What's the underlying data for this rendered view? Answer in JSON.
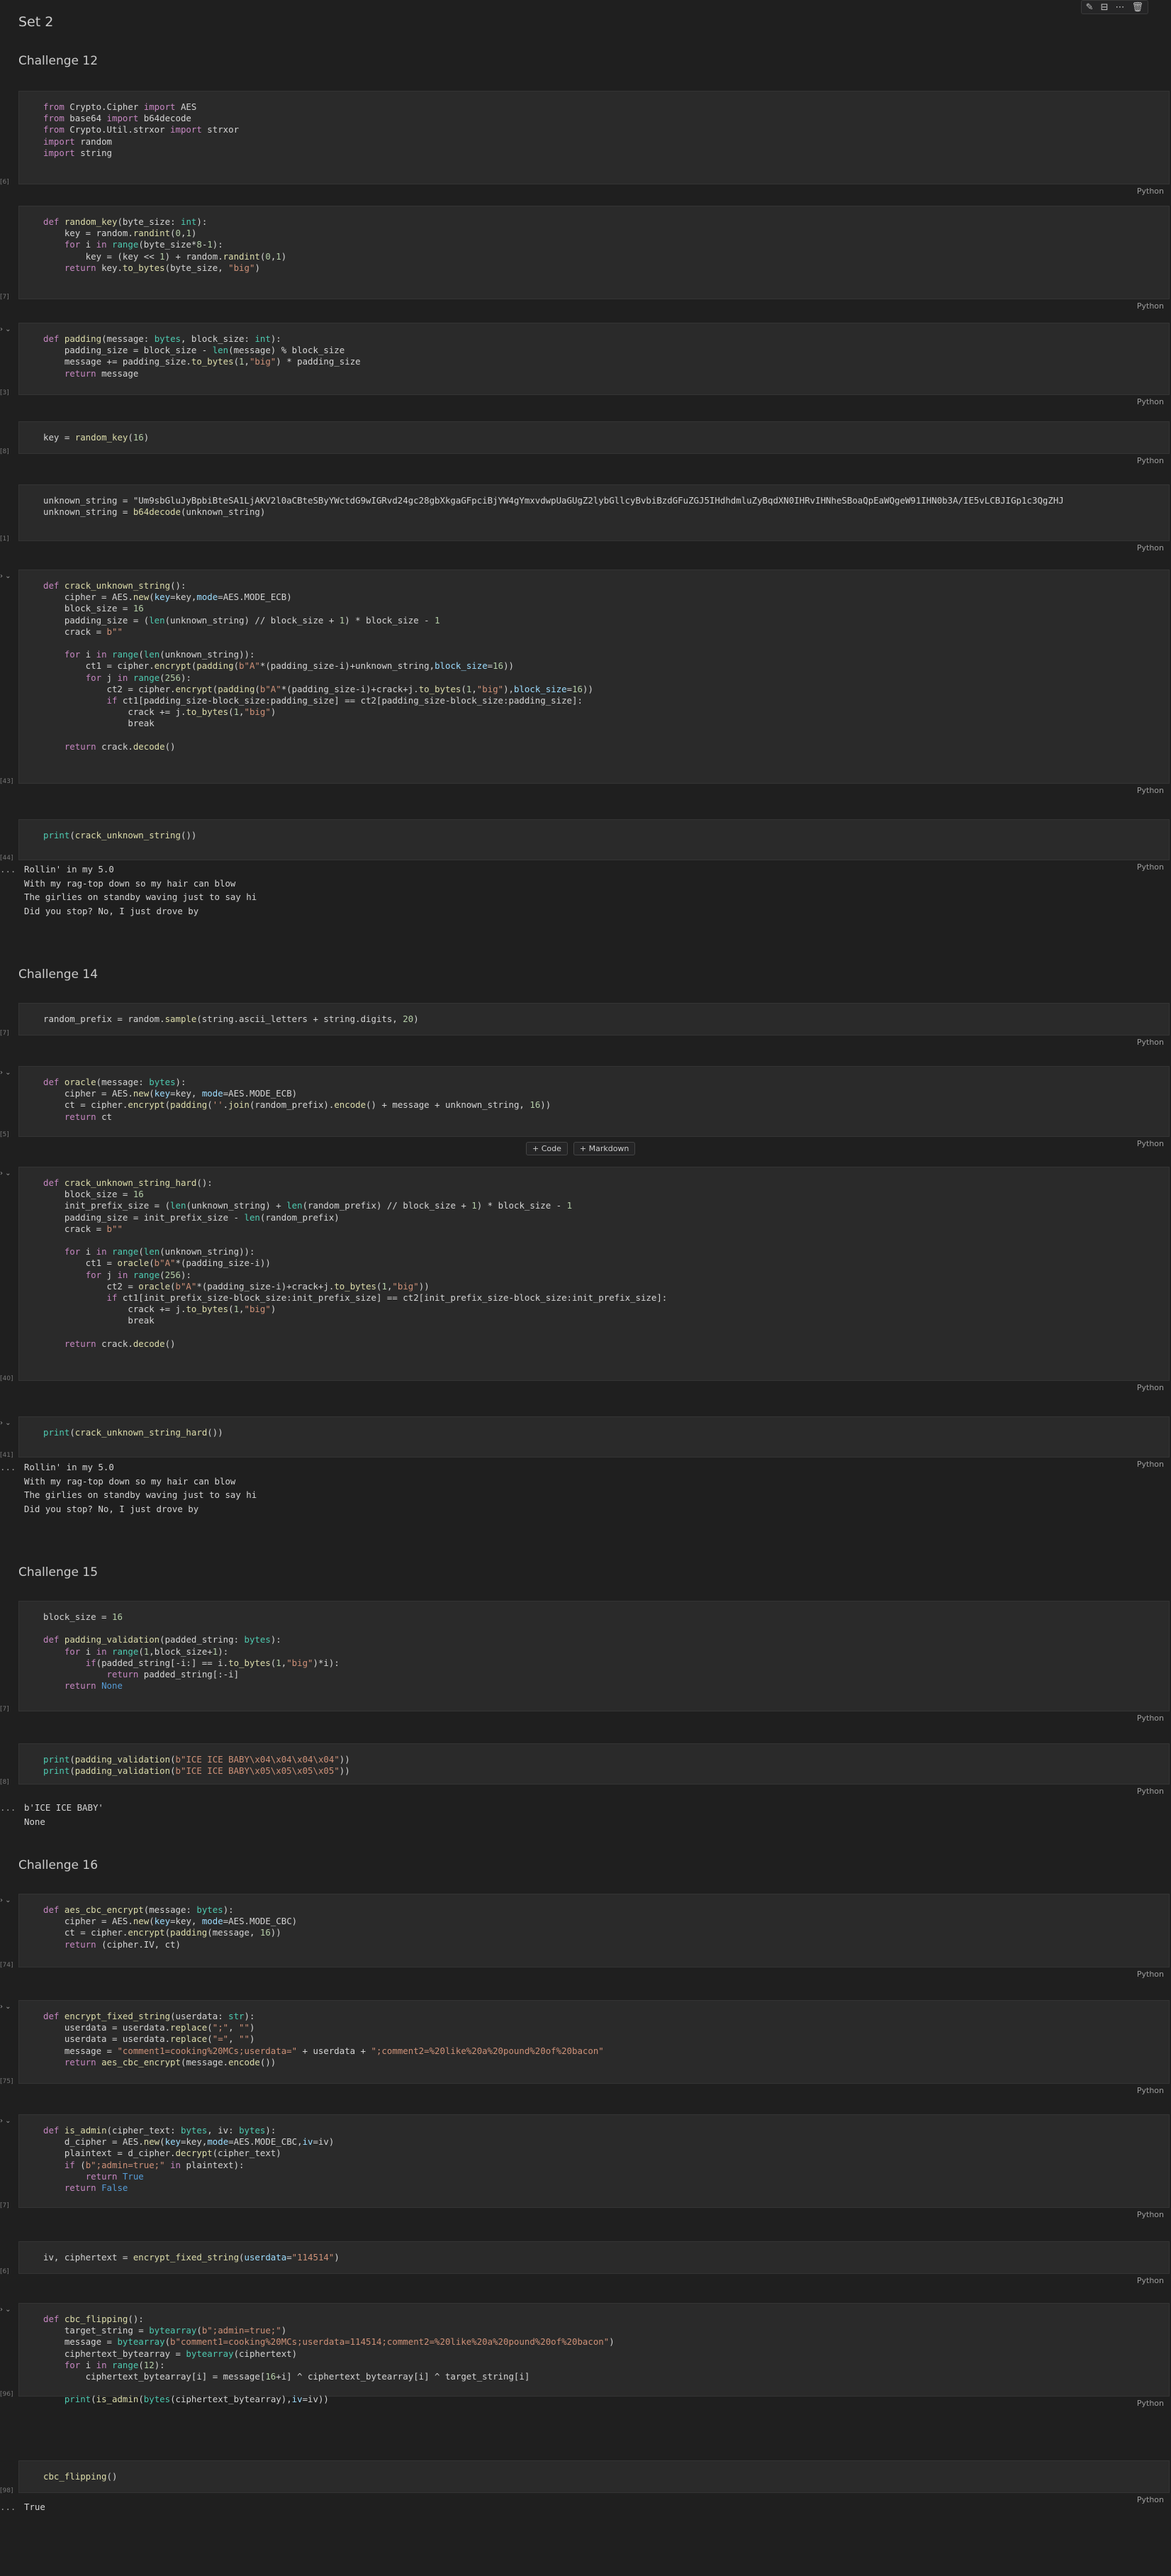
{
  "toolbar": {
    "items": [
      "✎",
      "⊟",
      "⋯",
      "🗑"
    ]
  },
  "insert": {
    "code": "+ Code",
    "markdown": "+ Markdown"
  },
  "headings": {
    "set": "Set 2",
    "c12": "Challenge 12",
    "c14": "Challenge 14",
    "c15": "Challenge 15",
    "c16": "Challenge 16"
  },
  "lang": "Python",
  "outputs": {
    "o1": "Rollin' in my 5.0\nWith my rag-top down so my hair can blow\nThe girlies on standby waving just to say hi\nDid you stop? No, I just drove by",
    "o2": "Rollin' in my 5.0\nWith my rag-top down so my hair can blow\nThe girlies on standby waving just to say hi\nDid you stop? No, I just drove by",
    "o3": "b'ICE ICE BABY'\nNone",
    "o4": "True"
  },
  "cells": [
    "from Crypto.Cipher import AES\nfrom base64 import b64decode\nfrom Crypto.Util.strxor import strxor\nimport random\nimport string",
    "def random_key(byte_size: int):\n    key = random.randint(0,1)\n    for i in range(byte_size*8-1):\n        key = (key << 1) + random.randint(0,1)\n    return key.to_bytes(byte_size, \"big\")",
    "def padding(message: bytes, block_size: int):\n    padding_size = block_size - len(message) % block_size\n    message += padding_size.to_bytes(1,\"big\") * padding_size\n    return message",
    "key = random_key(16)",
    "unknown_string = \"Um9sbGluJyBpbiBteSA1LjAKV2l0aCBteSByYWctdG9wIGRvd24gc28gbXkgaGFpciBjYW4gYmxvdwpUaGUgZ2lybGllcyBvbiBzdGFuZGJ5IHdhdmluZyBqdXN0IHRvIHNheSBoaQpEaWQgeW91IHN0b3A/IE5vLCBJIGp1c3QgZHJ\nunknown_string = b64decode(unknown_string)",
    "def crack_unknown_string():\n    cipher = AES.new(key=key,mode=AES.MODE_ECB)\n    block_size = 16\n    padding_size = (len(unknown_string) // block_size + 1) * block_size - 1\n    crack = b\"\"\n\n    for i in range(len(unknown_string)):\n        ct1 = cipher.encrypt(padding(b\"A\"*(padding_size-i)+unknown_string,block_size=16))\n        for j in range(256):\n            ct2 = cipher.encrypt(padding(b\"A\"*(padding_size-i)+crack+j.to_bytes(1,\"big\"),block_size=16))\n            if ct1[padding_size-block_size:padding_size] == ct2[padding_size-block_size:padding_size]:\n                crack += j.to_bytes(1,\"big\")\n                break\n\n    return crack.decode()",
    "print(crack_unknown_string())",
    "random_prefix = random.sample(string.ascii_letters + string.digits, 20)",
    "def oracle(message: bytes):\n    cipher = AES.new(key=key, mode=AES.MODE_ECB)\n    ct = cipher.encrypt(padding(''.join(random_prefix).encode() + message + unknown_string, 16))\n    return ct",
    "def crack_unknown_string_hard():\n    block_size = 16\n    init_prefix_size = (len(unknown_string) + len(random_prefix) // block_size + 1) * block_size - 1\n    padding_size = init_prefix_size - len(random_prefix)\n    crack = b\"\"\n\n    for i in range(len(unknown_string)):\n        ct1 = oracle(b\"A\"*(padding_size-i))\n        for j in range(256):\n            ct2 = oracle(b\"A\"*(padding_size-i)+crack+j.to_bytes(1,\"big\"))\n            if ct1[init_prefix_size-block_size:init_prefix_size] == ct2[init_prefix_size-block_size:init_prefix_size]:\n                crack += j.to_bytes(1,\"big\")\n                break\n\n    return crack.decode()",
    "print(crack_unknown_string_hard())",
    "block_size = 16\n\ndef padding_validation(padded_string: bytes):\n    for i in range(1,block_size+1):\n        if(padded_string[-i:] == i.to_bytes(1,\"big\")*i):\n            return padded_string[:-i]\n    return None",
    "print(padding_validation(b\"ICE ICE BABY\\x04\\x04\\x04\\x04\"))\nprint(padding_validation(b\"ICE ICE BABY\\x05\\x05\\x05\\x05\"))",
    "def aes_cbc_encrypt(message: bytes):\n    cipher = AES.new(key=key, mode=AES.MODE_CBC)\n    ct = cipher.encrypt(padding(message, 16))\n    return (cipher.IV, ct)",
    "def encrypt_fixed_string(userdata: str):\n    userdata = userdata.replace(\";\", \"\")\n    userdata = userdata.replace(\"=\", \"\")\n    message = \"comment1=cooking%20MCs;userdata=\" + userdata + \";comment2=%20like%20a%20pound%20of%20bacon\"\n    return aes_cbc_encrypt(message.encode())",
    "def is_admin(cipher_text: bytes, iv: bytes):\n    d_cipher = AES.new(key=key,mode=AES.MODE_CBC,iv=iv)\n    plaintext = d_cipher.decrypt(cipher_text)\n    if (b\";admin=true;\" in plaintext):\n        return True\n    return False",
    "iv, ciphertext = encrypt_fixed_string(userdata=\"114514\")",
    "def cbc_flipping():\n    target_string = bytearray(b\";admin=true;\")\n    message = bytearray(b\"comment1=cooking%20MCs;userdata=114514;comment2=%20like%20a%20pound%20of%20bacon\")\n    ciphertext_bytearray = bytearray(ciphertext)\n    for i in range(12):\n        ciphertext_bytearray[i] = message[16+i] ^ ciphertext_bytearray[i] ^ target_string[i]\n\n    print(is_admin(bytes(ciphertext_bytearray),iv=iv))",
    "cbc_flipping()"
  ],
  "counts": [
    "[6]",
    "[7]",
    "[3]",
    "[8]",
    "[1]",
    "[43]",
    "[44]",
    "[7]",
    "[5]",
    "[40]",
    "[41]",
    "[7]",
    "[8]",
    "[74]",
    "[75]",
    "[7]",
    "[6]",
    "[96]",
    "[98]"
  ]
}
